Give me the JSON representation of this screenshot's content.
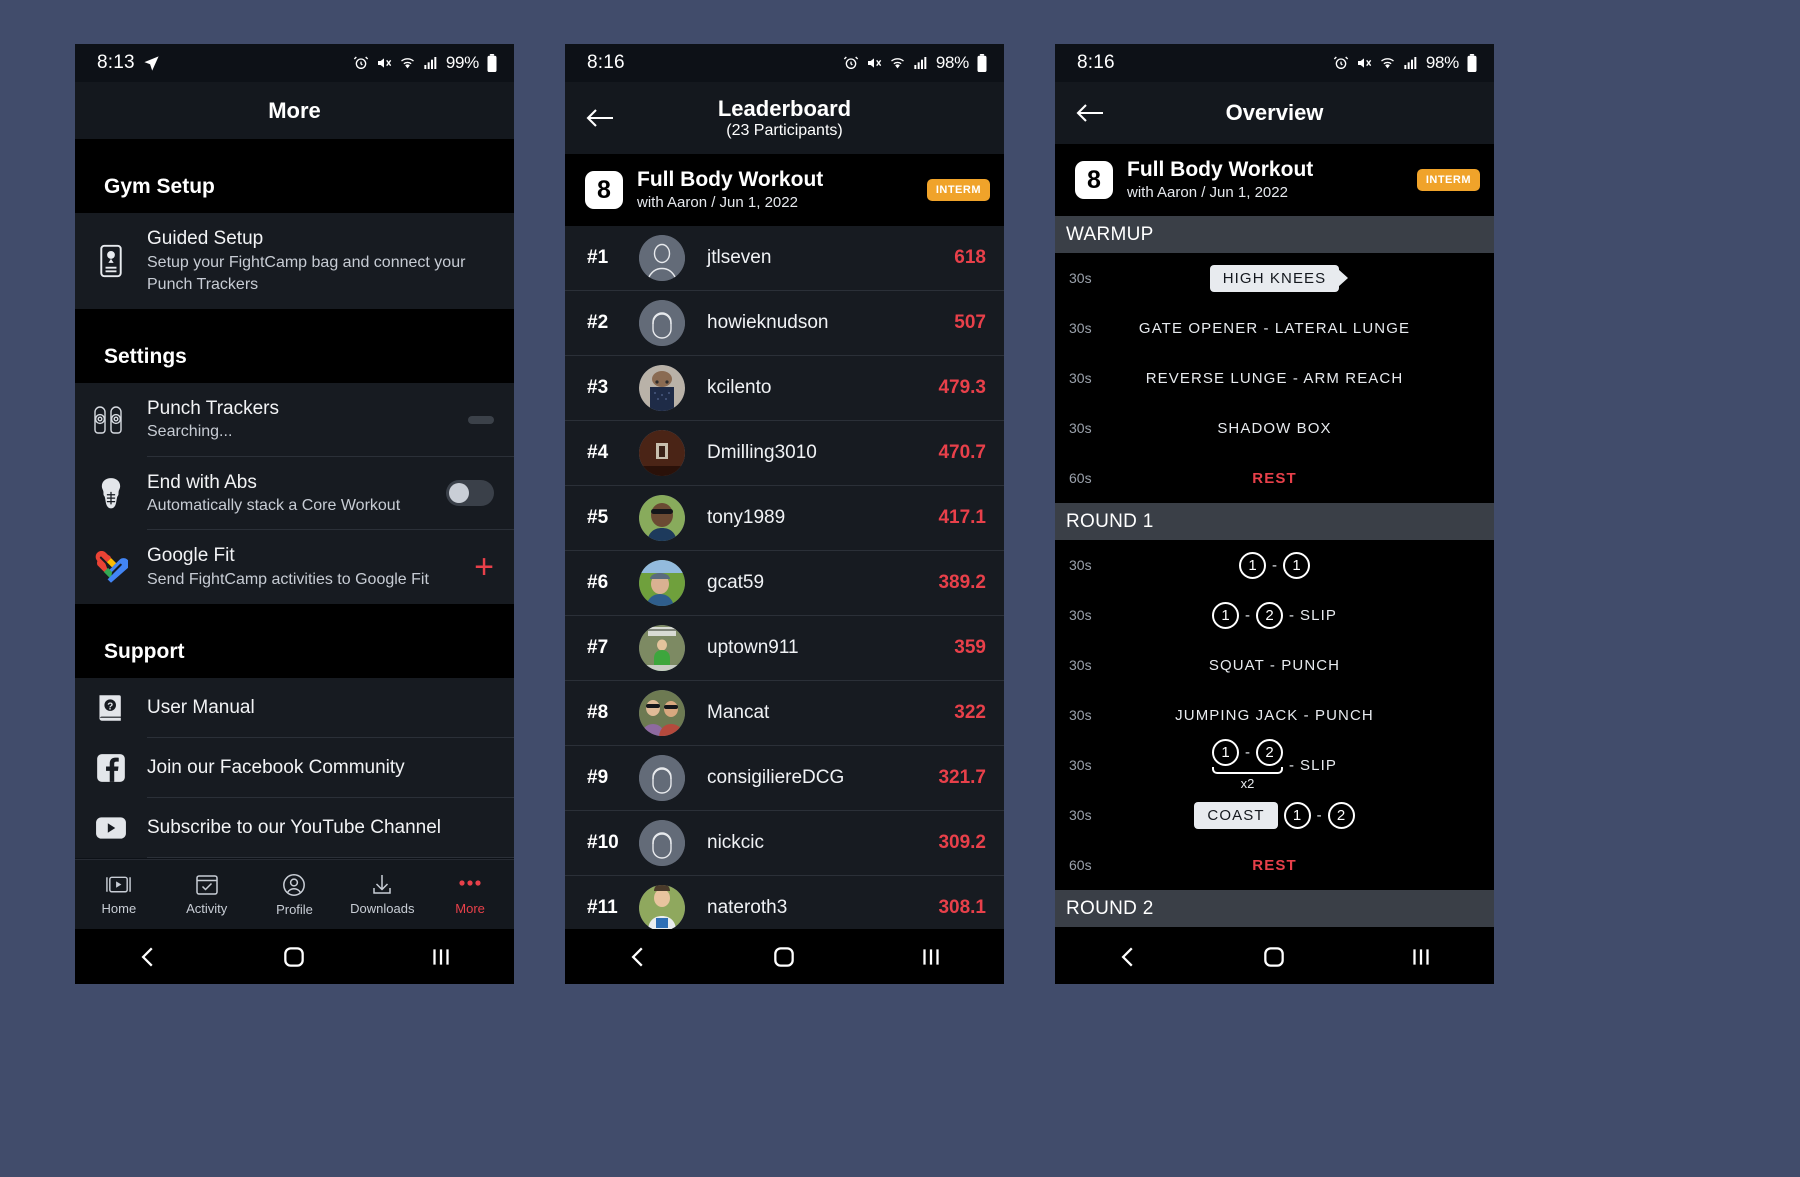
{
  "phone1": {
    "status": {
      "time": "8:13",
      "battery": "99%"
    },
    "appbar": {
      "title": "More"
    },
    "sections": [
      {
        "heading": "Gym Setup"
      },
      {
        "heading": "Settings"
      },
      {
        "heading": "Support"
      }
    ],
    "gym_setup": [
      {
        "icon": "guided-setup-icon",
        "title": "Guided Setup",
        "subtitle": "Setup your FightCamp bag and connect your Punch Trackers"
      }
    ],
    "settings": [
      {
        "icon": "punch-trackers-icon",
        "title": "Punch Trackers",
        "subtitle": "Searching...",
        "control": "loading"
      },
      {
        "icon": "abs-icon",
        "title": "End with Abs",
        "subtitle": "Automatically stack a Core Workout",
        "control": "toggle-off"
      },
      {
        "icon": "google-fit-icon",
        "title": "Google Fit",
        "subtitle": "Send FightCamp activities to Google Fit",
        "control": "plus"
      }
    ],
    "support": [
      {
        "icon": "user-manual-icon",
        "title": "User Manual"
      },
      {
        "icon": "facebook-icon",
        "title": "Join our Facebook Community"
      },
      {
        "icon": "youtube-icon",
        "title": "Subscribe to our YouTube Channel"
      }
    ],
    "tabs": [
      {
        "icon": "play-home-icon",
        "label": "Home",
        "active": false
      },
      {
        "icon": "activity-check-icon",
        "label": "Activity",
        "active": false
      },
      {
        "icon": "profile-icon",
        "label": "Profile",
        "active": false
      },
      {
        "icon": "download-icon",
        "label": "Downloads",
        "active": false
      },
      {
        "icon": "more-dots-icon",
        "label": "More",
        "active": true
      }
    ]
  },
  "phone2": {
    "status": {
      "time": "8:16",
      "battery": "98%"
    },
    "appbar": {
      "title": "Leaderboard",
      "subtitle": "(23 Participants)"
    },
    "workout": {
      "number": "8",
      "title": "Full Body Workout",
      "subtitle": "with Aaron / Jun 1, 2022",
      "badge": "INTERM"
    },
    "leaderboard": [
      {
        "rank": "#1",
        "name": "jtlseven",
        "score": "618",
        "avatar": "placeholder"
      },
      {
        "rank": "#2",
        "name": "howieknudson",
        "score": "507",
        "avatar": "placeholder2"
      },
      {
        "rank": "#3",
        "name": "kcilento",
        "score": "479.3",
        "avatar": "photo-mask"
      },
      {
        "rank": "#4",
        "name": "Dmilling3010",
        "score": "470.7",
        "avatar": "photo-dark"
      },
      {
        "rank": "#5",
        "name": "tony1989",
        "score": "417.1",
        "avatar": "photo-green"
      },
      {
        "rank": "#6",
        "name": "gcat59",
        "score": "389.2",
        "avatar": "photo-field"
      },
      {
        "rank": "#7",
        "name": "uptown911",
        "score": "359",
        "avatar": "photo-kid"
      },
      {
        "rank": "#8",
        "name": "Mancat",
        "score": "322",
        "avatar": "photo-couple"
      },
      {
        "rank": "#9",
        "name": "consigiliereDCG",
        "score": "321.7",
        "avatar": "placeholder2"
      },
      {
        "rank": "#10",
        "name": "nickcic",
        "score": "309.2",
        "avatar": "placeholder2"
      },
      {
        "rank": "#11",
        "name": "nateroth3",
        "score": "308.1",
        "avatar": "photo-shirt"
      }
    ]
  },
  "phone3": {
    "status": {
      "time": "8:16",
      "battery": "98%"
    },
    "appbar": {
      "title": "Overview"
    },
    "workout": {
      "number": "8",
      "title": "Full Body Workout",
      "subtitle": "with Aaron / Jun 1, 2022",
      "badge": "INTERM"
    },
    "blocks": [
      {
        "heading": "WARMUP",
        "rows": [
          {
            "time": "30s",
            "kind": "pill-arrow",
            "text": "HIGH KNEES"
          },
          {
            "time": "30s",
            "kind": "text",
            "text": "GATE OPENER  -  LATERAL LUNGE"
          },
          {
            "time": "30s",
            "kind": "text",
            "text": "REVERSE LUNGE  -  ARM REACH"
          },
          {
            "time": "30s",
            "kind": "text",
            "text": "SHADOW BOX"
          },
          {
            "time": "60s",
            "kind": "rest",
            "text": "REST"
          }
        ]
      },
      {
        "heading": "ROUND 1",
        "rows": [
          {
            "time": "30s",
            "kind": "combo",
            "circles": [
              "1",
              "1"
            ],
            "text": ""
          },
          {
            "time": "30s",
            "kind": "combo",
            "circles": [
              "1",
              "2"
            ],
            "text": "SLIP"
          },
          {
            "time": "30s",
            "kind": "text",
            "text": "SQUAT  -  PUNCH"
          },
          {
            "time": "30s",
            "kind": "text",
            "text": "JUMPING JACK  -  PUNCH"
          },
          {
            "time": "30s",
            "kind": "combo-x2",
            "circles": [
              "1",
              "2"
            ],
            "text": "SLIP",
            "repeat": "x2"
          },
          {
            "time": "30s",
            "kind": "coast",
            "pill": "COAST",
            "circles": [
              "1",
              "2"
            ],
            "text": ""
          },
          {
            "time": "60s",
            "kind": "rest",
            "text": "REST"
          }
        ]
      },
      {
        "heading": "ROUND 2",
        "rows": []
      }
    ]
  }
}
